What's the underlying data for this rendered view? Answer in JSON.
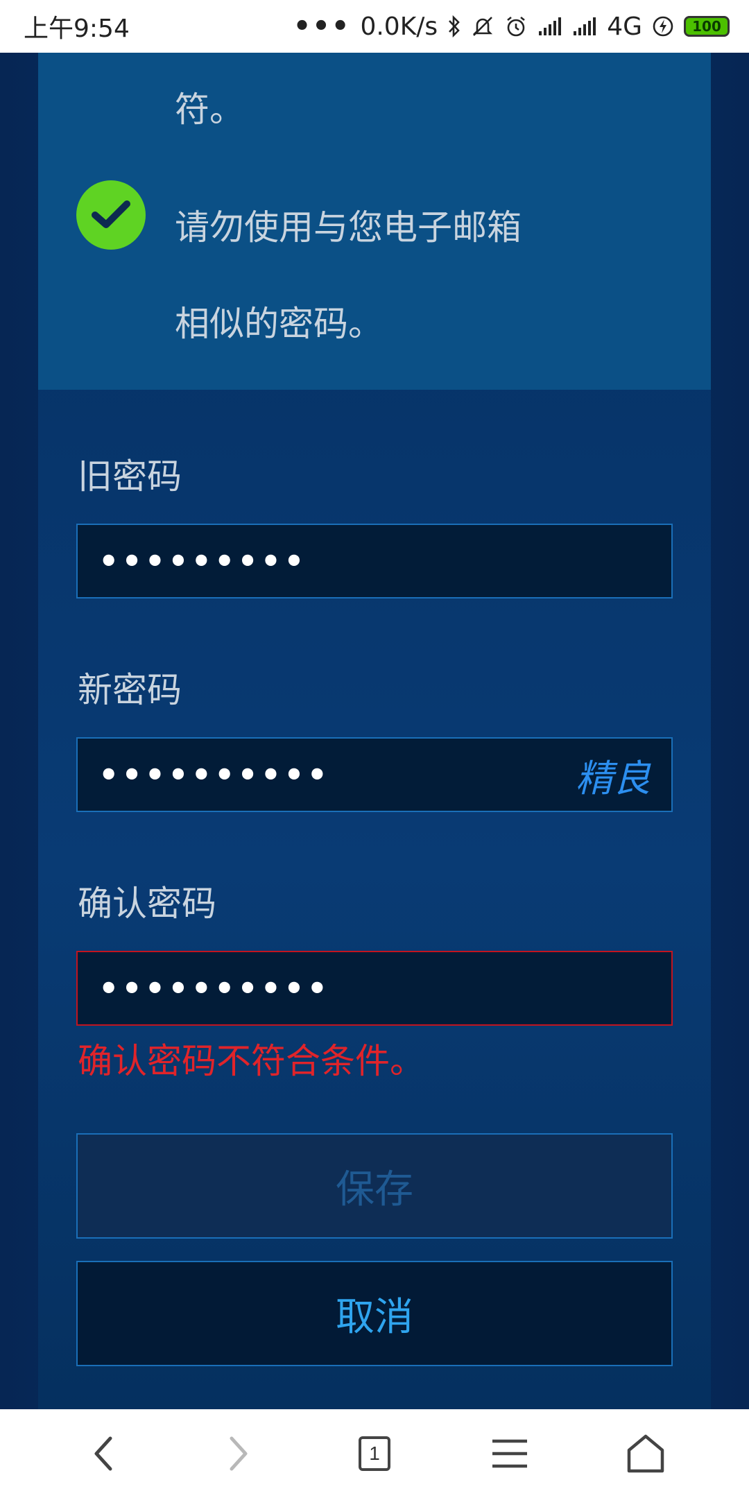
{
  "status_bar": {
    "time": "上午9:54",
    "dots": "•••",
    "network_speed": "0.0K/s",
    "network_type": "4G",
    "battery": "100",
    "icons": [
      "bluetooth-icon",
      "mute-icon",
      "alarm-icon",
      "signal-icon",
      "signal-icon",
      "charging-icon",
      "battery-icon"
    ]
  },
  "hints": {
    "line_1": "符。",
    "line_2": "请勿使用与您电子邮箱",
    "line_3": "相似的密码。",
    "check_color": "#5fd323"
  },
  "form": {
    "old_password": {
      "label": "旧密码",
      "value": "•••••••••"
    },
    "new_password": {
      "label": "新密码",
      "value": "••••••••••",
      "strength": "精良"
    },
    "confirm_password": {
      "label": "确认密码",
      "value": "••••••••••",
      "error": "确认密码不符合条件。"
    },
    "save_label": "保存",
    "cancel_label": "取消"
  },
  "nav": {
    "tab_count": "1",
    "icons": [
      "back-icon",
      "forward-icon",
      "tabs-icon",
      "menu-icon",
      "home-icon"
    ]
  },
  "colors": {
    "background": "#0a2a5c",
    "hint_panel": "#0b5086",
    "field_border": "#1a6fb8",
    "error": "#e0242a",
    "strength": "#2c8ff0",
    "cancel_text": "#2fa4ee"
  }
}
